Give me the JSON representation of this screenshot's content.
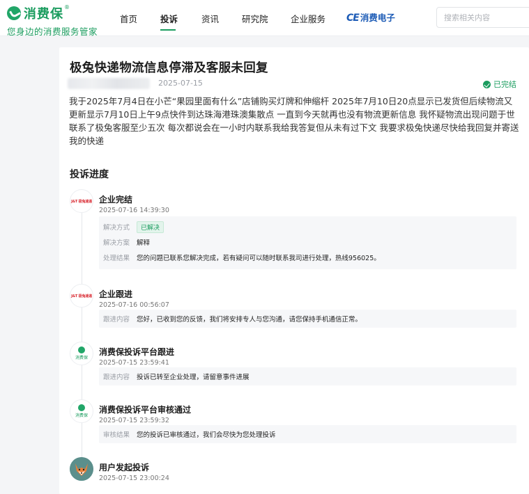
{
  "header": {
    "brand": "消费保",
    "slogan": "您身边的消费服务管家",
    "nav": [
      "首页",
      "投诉",
      "资讯",
      "研究院",
      "企业服务"
    ],
    "partner_mark": "CE",
    "partner_text": "消费电子",
    "search_placeholder": "搜索相关内容"
  },
  "complaint": {
    "title": "极兔快递物流信息停滞及客服未回复",
    "date": "2025-07-15",
    "status": "已完结",
    "description": "我于2025年7月4日在小芒“果园里面有什么”店铺购买灯牌和伸缩杆 2025年7月10日20点显示已发货但后续物流又更新显示7月10日上午9点快件到达珠海港珠澳集散点 一直到今天就再也没有物流更新信息 我怀疑物流出现问题于世联系了极兔客服至少五次 每次都说会在一小时内联系我给我答复但从未有过下文 我要求极兔快递尽快给我回复并寄送我的快递"
  },
  "progress": {
    "title": "投诉进度",
    "steps": [
      {
        "name": "企业完结",
        "time": "2025-07-16 14:39:30",
        "logo_text": "J&T 极兔速递",
        "rows": [
          {
            "label": "解决方式",
            "value": "已解决"
          },
          {
            "label": "解决方案",
            "value": "解释"
          },
          {
            "label": "处理结果",
            "value": "您的问题已联系您解决完成，若有疑问可以随时联系我司进行处理，热线956025。"
          }
        ]
      },
      {
        "name": "企业跟进",
        "time": "2025-07-16 00:56:07",
        "logo_text": "J&T 极兔速递",
        "rows": [
          {
            "label": "跟进内容",
            "value": "您好，已收到您的反馈，我们将安排专人与您沟通，请您保持手机通信正常。"
          }
        ]
      },
      {
        "name": "消费保投诉平台跟进",
        "time": "2025-07-15 23:59:41",
        "logo_text": "消费保",
        "rows": [
          {
            "label": "跟进内容",
            "value": "投诉已转至企业处理，请留意事件进展"
          }
        ]
      },
      {
        "name": "消费保投诉平台审核通过",
        "time": "2025-07-15 23:59:32",
        "logo_text": "消费保",
        "rows": [
          {
            "label": "审核结果",
            "value": "您的投诉已审核通过，我们会尽快为您处理投诉"
          }
        ]
      },
      {
        "name": "用户发起投诉",
        "time": "2025-07-15 23:00:24"
      }
    ]
  },
  "colors": {
    "brand_green": "#1a9c5e",
    "partner_blue": "#1c5bb6",
    "jt_red": "#d8262e"
  }
}
